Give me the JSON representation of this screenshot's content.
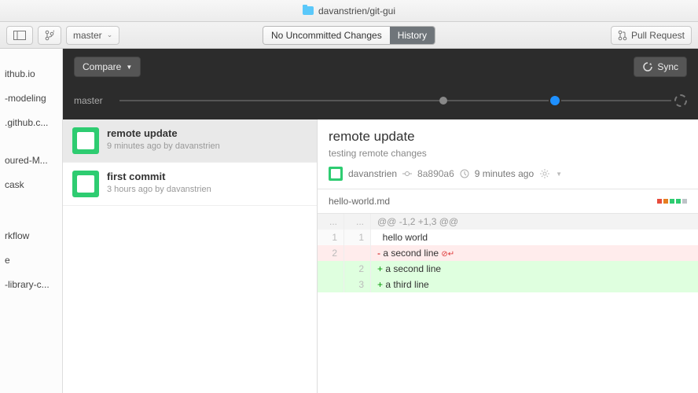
{
  "title": "davanstrien/git-gui",
  "toolbar": {
    "branch": "master",
    "seg_changes": "No Uncommitted Changes",
    "seg_history": "History",
    "pull_request": "Pull Request"
  },
  "compare": {
    "label": "Compare",
    "sync": "Sync"
  },
  "timeline": {
    "branch": "master"
  },
  "repos": [
    "",
    "ithub.io",
    "-modeling",
    ".github.c...",
    "",
    "oured-M...",
    "cask",
    "",
    "",
    "rkflow",
    "e",
    "-library-c...",
    ""
  ],
  "commits": [
    {
      "title": "remote update",
      "meta": "9 minutes ago by davanstrien",
      "selected": true
    },
    {
      "title": "first commit",
      "meta": "3 hours ago by davanstrien",
      "selected": false
    }
  ],
  "detail": {
    "title": "remote update",
    "desc": "testing remote changes",
    "author": "davanstrien",
    "sha": "8a890a6",
    "time": "9 minutes ago",
    "file": "hello-world.md",
    "hunk": "@@ -1,2 +1,3 @@"
  },
  "diff": [
    {
      "type": "ctx",
      "a": "1",
      "b": "1",
      "text": "hello world"
    },
    {
      "type": "del",
      "a": "2",
      "b": "",
      "text": "a second line "
    },
    {
      "type": "add",
      "a": "",
      "b": "2",
      "text": "a second line"
    },
    {
      "type": "add",
      "a": "",
      "b": "3",
      "text": "a third line"
    }
  ]
}
